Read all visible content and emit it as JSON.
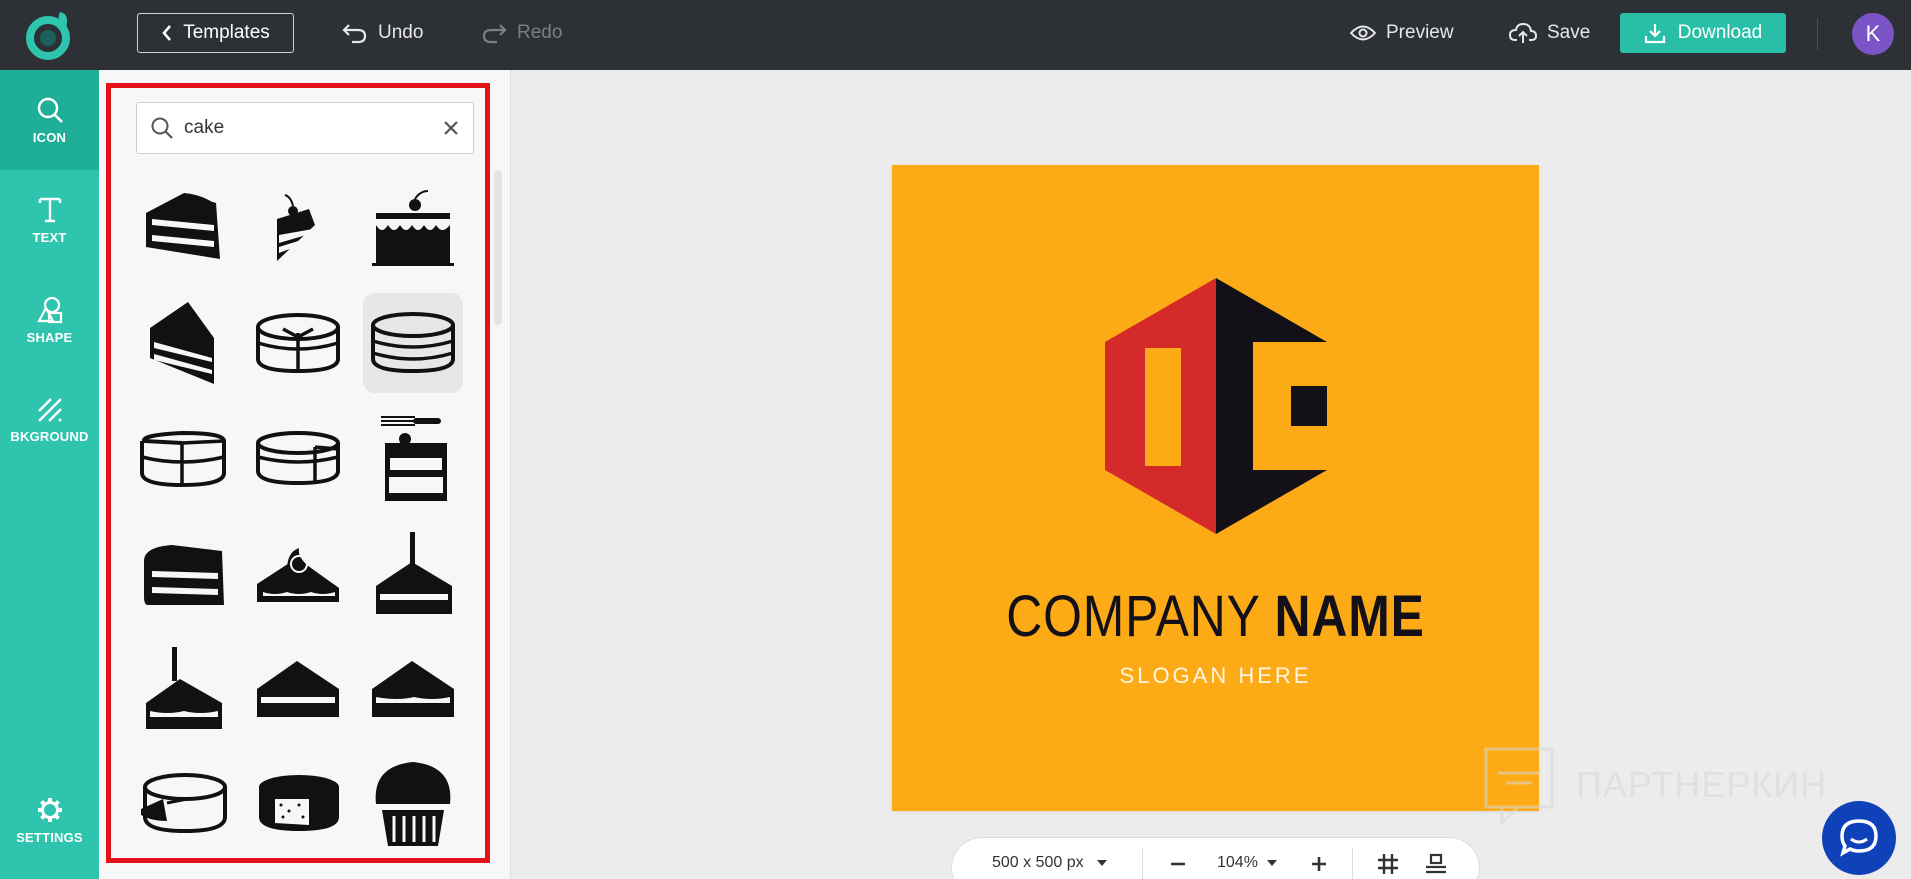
{
  "topbar": {
    "logo_icon": "brand-logo-icon",
    "templates_label": "Templates",
    "undo_label": "Undo",
    "redo_label": "Redo",
    "preview_label": "Preview",
    "save_label": "Save",
    "download_label": "Download",
    "avatar_initial": "K",
    "colors": {
      "background": "#2d3136",
      "download": "#29bfa6",
      "avatar": "#7b55c7"
    }
  },
  "rail": {
    "items": [
      {
        "label": "ICON",
        "icon": "search-icon",
        "active": true
      },
      {
        "label": "TEXT",
        "icon": "text-icon",
        "active": false
      },
      {
        "label": "SHAPE",
        "icon": "shape-icon",
        "active": false
      },
      {
        "label": "BKGROUND",
        "icon": "background-icon",
        "active": false
      }
    ],
    "settings_label": "SETTINGS",
    "colors": {
      "background": "#2ec4ad",
      "active": "#1fae98"
    }
  },
  "panel": {
    "search_value": "cake",
    "highlight_color": "#e3121b",
    "icons": [
      "cake-slice-layered-icon",
      "cake-slice-cherry-icon",
      "cake-drip-cherry-icon",
      "cake-slice-striped-icon",
      "layer-cake-cut-icon",
      "round-cake-icon",
      "cake-missing-slice-icon",
      "cake-cut-slice-icon",
      "cake-slice-fork-icon",
      "cake-slice-frosted-icon",
      "cake-slice-cream-icon",
      "cake-slice-candle-icon",
      "cake-slice-candle-small-icon",
      "cake-slice-wedge-icon",
      "cake-slice-wedge-layers-icon",
      "whole-cake-sliced-icon",
      "cheesecake-icon",
      "cupcake-icon"
    ]
  },
  "canvas": {
    "company_word1": "COMPANY",
    "company_word2": "NAME",
    "slogan": "SLOGAN HERE",
    "colors": {
      "background": "#fcab16",
      "mark_left": "#d42a2a",
      "mark_right": "#131017",
      "slogan": "#fff5e0"
    }
  },
  "bottombar": {
    "size_label": "500 x 500 px",
    "zoom_label": "104%"
  },
  "watermark": "ПАРТНЕРКИН"
}
